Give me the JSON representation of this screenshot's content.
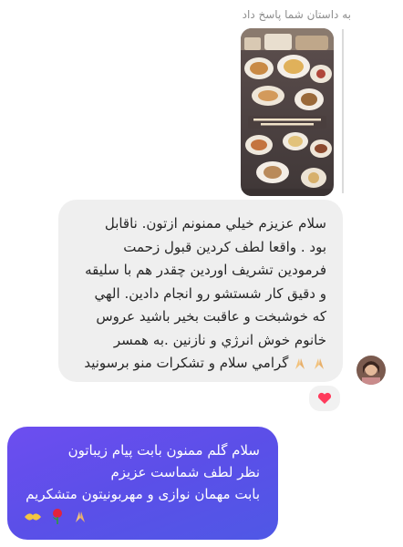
{
  "story_reply": {
    "header": "به داستان شما پاسخ داد"
  },
  "incoming": {
    "lines": [
      "سلام عزیزم خیلي ممنونم ازتون.  ناقابل",
      "بود . واقعا لطف کردین قبول زحمت",
      "فرمودین تشریف اوردین چقدر هم با سلیقه",
      "و دقیق کار شستشو رو انجام دادین. الهي",
      "که خوشبخت و عاقبت بخیر باشید عروس",
      "خانوم خوش انرژي و نازنین .به همسر",
      "گرامي سلام و تشکرات منو برسونید"
    ],
    "reaction_icon": "heart-emoji"
  },
  "outgoing": {
    "lines": [
      "سلام گلم ممنون بابت پیام زیباتون",
      "نظر لطف شماست عزیزم",
      "بابت مهمان نوازی و مهربونیتون متشکریم"
    ],
    "emoji_icons": [
      "handshake-emoji",
      "rose-emoji",
      "folded-hands-emoji"
    ]
  },
  "colors": {
    "incoming_bg": "#efefef",
    "outgoing_bg": "#5b4fe8",
    "reaction": "#ff3b5c"
  }
}
